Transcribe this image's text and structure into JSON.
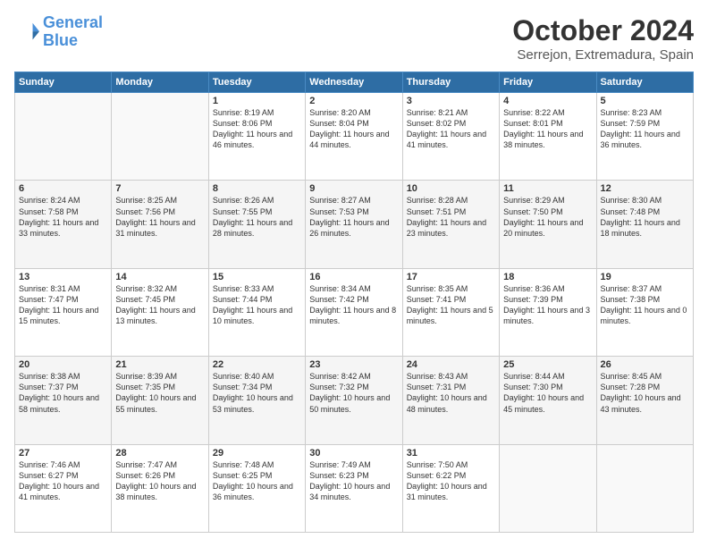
{
  "header": {
    "logo_line1": "General",
    "logo_line2": "Blue",
    "title": "October 2024",
    "subtitle": "Serrejon, Extremadura, Spain"
  },
  "weekdays": [
    "Sunday",
    "Monday",
    "Tuesday",
    "Wednesday",
    "Thursday",
    "Friday",
    "Saturday"
  ],
  "weeks": [
    [
      {
        "day": "",
        "info": ""
      },
      {
        "day": "",
        "info": ""
      },
      {
        "day": "1",
        "info": "Sunrise: 8:19 AM\nSunset: 8:06 PM\nDaylight: 11 hours and 46 minutes."
      },
      {
        "day": "2",
        "info": "Sunrise: 8:20 AM\nSunset: 8:04 PM\nDaylight: 11 hours and 44 minutes."
      },
      {
        "day": "3",
        "info": "Sunrise: 8:21 AM\nSunset: 8:02 PM\nDaylight: 11 hours and 41 minutes."
      },
      {
        "day": "4",
        "info": "Sunrise: 8:22 AM\nSunset: 8:01 PM\nDaylight: 11 hours and 38 minutes."
      },
      {
        "day": "5",
        "info": "Sunrise: 8:23 AM\nSunset: 7:59 PM\nDaylight: 11 hours and 36 minutes."
      }
    ],
    [
      {
        "day": "6",
        "info": "Sunrise: 8:24 AM\nSunset: 7:58 PM\nDaylight: 11 hours and 33 minutes."
      },
      {
        "day": "7",
        "info": "Sunrise: 8:25 AM\nSunset: 7:56 PM\nDaylight: 11 hours and 31 minutes."
      },
      {
        "day": "8",
        "info": "Sunrise: 8:26 AM\nSunset: 7:55 PM\nDaylight: 11 hours and 28 minutes."
      },
      {
        "day": "9",
        "info": "Sunrise: 8:27 AM\nSunset: 7:53 PM\nDaylight: 11 hours and 26 minutes."
      },
      {
        "day": "10",
        "info": "Sunrise: 8:28 AM\nSunset: 7:51 PM\nDaylight: 11 hours and 23 minutes."
      },
      {
        "day": "11",
        "info": "Sunrise: 8:29 AM\nSunset: 7:50 PM\nDaylight: 11 hours and 20 minutes."
      },
      {
        "day": "12",
        "info": "Sunrise: 8:30 AM\nSunset: 7:48 PM\nDaylight: 11 hours and 18 minutes."
      }
    ],
    [
      {
        "day": "13",
        "info": "Sunrise: 8:31 AM\nSunset: 7:47 PM\nDaylight: 11 hours and 15 minutes."
      },
      {
        "day": "14",
        "info": "Sunrise: 8:32 AM\nSunset: 7:45 PM\nDaylight: 11 hours and 13 minutes."
      },
      {
        "day": "15",
        "info": "Sunrise: 8:33 AM\nSunset: 7:44 PM\nDaylight: 11 hours and 10 minutes."
      },
      {
        "day": "16",
        "info": "Sunrise: 8:34 AM\nSunset: 7:42 PM\nDaylight: 11 hours and 8 minutes."
      },
      {
        "day": "17",
        "info": "Sunrise: 8:35 AM\nSunset: 7:41 PM\nDaylight: 11 hours and 5 minutes."
      },
      {
        "day": "18",
        "info": "Sunrise: 8:36 AM\nSunset: 7:39 PM\nDaylight: 11 hours and 3 minutes."
      },
      {
        "day": "19",
        "info": "Sunrise: 8:37 AM\nSunset: 7:38 PM\nDaylight: 11 hours and 0 minutes."
      }
    ],
    [
      {
        "day": "20",
        "info": "Sunrise: 8:38 AM\nSunset: 7:37 PM\nDaylight: 10 hours and 58 minutes."
      },
      {
        "day": "21",
        "info": "Sunrise: 8:39 AM\nSunset: 7:35 PM\nDaylight: 10 hours and 55 minutes."
      },
      {
        "day": "22",
        "info": "Sunrise: 8:40 AM\nSunset: 7:34 PM\nDaylight: 10 hours and 53 minutes."
      },
      {
        "day": "23",
        "info": "Sunrise: 8:42 AM\nSunset: 7:32 PM\nDaylight: 10 hours and 50 minutes."
      },
      {
        "day": "24",
        "info": "Sunrise: 8:43 AM\nSunset: 7:31 PM\nDaylight: 10 hours and 48 minutes."
      },
      {
        "day": "25",
        "info": "Sunrise: 8:44 AM\nSunset: 7:30 PM\nDaylight: 10 hours and 45 minutes."
      },
      {
        "day": "26",
        "info": "Sunrise: 8:45 AM\nSunset: 7:28 PM\nDaylight: 10 hours and 43 minutes."
      }
    ],
    [
      {
        "day": "27",
        "info": "Sunrise: 7:46 AM\nSunset: 6:27 PM\nDaylight: 10 hours and 41 minutes."
      },
      {
        "day": "28",
        "info": "Sunrise: 7:47 AM\nSunset: 6:26 PM\nDaylight: 10 hours and 38 minutes."
      },
      {
        "day": "29",
        "info": "Sunrise: 7:48 AM\nSunset: 6:25 PM\nDaylight: 10 hours and 36 minutes."
      },
      {
        "day": "30",
        "info": "Sunrise: 7:49 AM\nSunset: 6:23 PM\nDaylight: 10 hours and 34 minutes."
      },
      {
        "day": "31",
        "info": "Sunrise: 7:50 AM\nSunset: 6:22 PM\nDaylight: 10 hours and 31 minutes."
      },
      {
        "day": "",
        "info": ""
      },
      {
        "day": "",
        "info": ""
      }
    ]
  ]
}
